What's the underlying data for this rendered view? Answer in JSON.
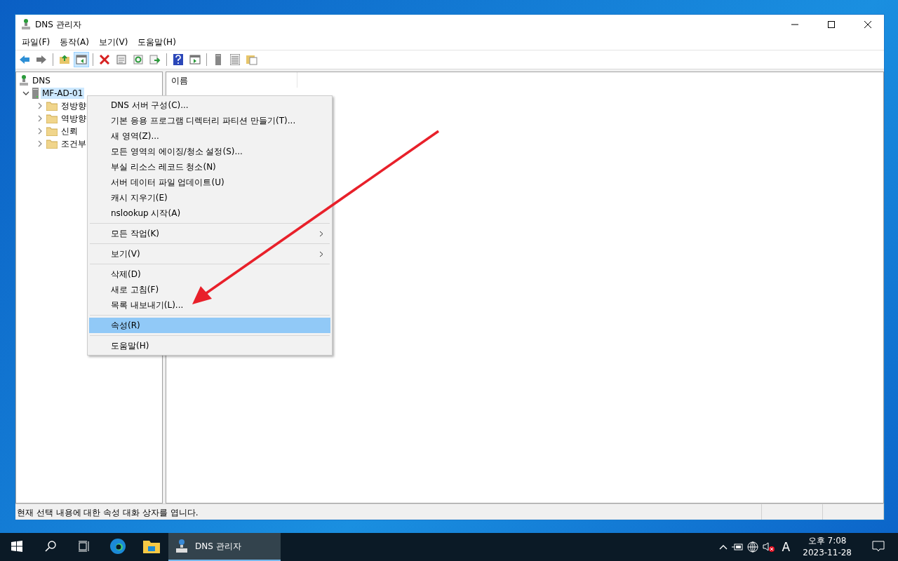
{
  "window": {
    "title": "DNS 관리자"
  },
  "menu_bar": [
    {
      "label": "파일(F)"
    },
    {
      "label": "동작(A)"
    },
    {
      "label": "보기(V)"
    },
    {
      "label": "도움말(H)"
    }
  ],
  "toolbar": [
    {
      "kind": "back",
      "selected": false
    },
    {
      "kind": "forward",
      "selected": false
    },
    {
      "kind": "sep"
    },
    {
      "kind": "up",
      "selected": false
    },
    {
      "kind": "pane",
      "selected": true
    },
    {
      "kind": "sep"
    },
    {
      "kind": "delete",
      "selected": false
    },
    {
      "kind": "props",
      "selected": false
    },
    {
      "kind": "refresh",
      "selected": false
    },
    {
      "kind": "export",
      "selected": false
    },
    {
      "kind": "sep"
    },
    {
      "kind": "help",
      "selected": false
    },
    {
      "kind": "action",
      "selected": false
    },
    {
      "kind": "sep"
    },
    {
      "kind": "server",
      "selected": false
    },
    {
      "kind": "list",
      "selected": false
    },
    {
      "kind": "folders",
      "selected": false
    }
  ],
  "tree": [
    {
      "label": "DNS",
      "kind": "root",
      "selected": false,
      "children": [
        {
          "label": "MF-AD-01",
          "kind": "server",
          "selected": true,
          "expanded": true,
          "children": [
            {
              "label": "정방향",
              "kind": "folder",
              "selected": false,
              "expanded": false
            },
            {
              "label": "역방향",
              "kind": "folder",
              "selected": false,
              "expanded": false
            },
            {
              "label": "신뢰",
              "kind": "folder",
              "selected": false,
              "expanded": false
            },
            {
              "label": "조건부",
              "kind": "folder",
              "selected": false,
              "expanded": false
            }
          ]
        }
      ]
    }
  ],
  "list": {
    "columns": [
      "이름"
    ]
  },
  "context_menu": [
    {
      "kind": "item",
      "label": "DNS 서버 구성(C)...",
      "selected": false
    },
    {
      "kind": "item",
      "label": "기본 응용 프로그램 디렉터리 파티션 만들기(T)...",
      "selected": false
    },
    {
      "kind": "item",
      "label": "새 영역(Z)...",
      "selected": false
    },
    {
      "kind": "item",
      "label": "모든 영역의 에이징/청소 설정(S)...",
      "selected": false
    },
    {
      "kind": "item",
      "label": "부실 리소스 레코드 청소(N)",
      "selected": false
    },
    {
      "kind": "item",
      "label": "서버 데이터 파일 업데이트(U)",
      "selected": false
    },
    {
      "kind": "item",
      "label": "캐시 지우기(E)",
      "selected": false
    },
    {
      "kind": "item",
      "label": "nslookup 시작(A)",
      "selected": false
    },
    {
      "kind": "separator"
    },
    {
      "kind": "submenu",
      "label": "모든 작업(K)",
      "selected": false
    },
    {
      "kind": "separator"
    },
    {
      "kind": "submenu",
      "label": "보기(V)",
      "selected": false
    },
    {
      "kind": "separator"
    },
    {
      "kind": "item",
      "label": "삭제(D)",
      "selected": false
    },
    {
      "kind": "item",
      "label": "새로 고침(F)",
      "selected": false
    },
    {
      "kind": "item",
      "label": "목록 내보내기(L)...",
      "selected": false
    },
    {
      "kind": "separator"
    },
    {
      "kind": "item",
      "label": "속성(R)",
      "selected": true
    },
    {
      "kind": "separator"
    },
    {
      "kind": "item",
      "label": "도움말(H)",
      "selected": false
    }
  ],
  "status_bar": {
    "text": "현재 선택 내용에 대한 속성 대화 상자를 엽니다."
  },
  "annotation": {
    "kind": "arrow"
  },
  "taskbar": {
    "apps": [
      {
        "kind": "edge",
        "selected": false
      },
      {
        "kind": "explorer",
        "selected": false
      },
      {
        "kind": "dns",
        "label": "DNS 관리자",
        "selected": true
      }
    ],
    "time": "오후 7:08",
    "date": "2023-11-28",
    "input_indicator": "A"
  }
}
